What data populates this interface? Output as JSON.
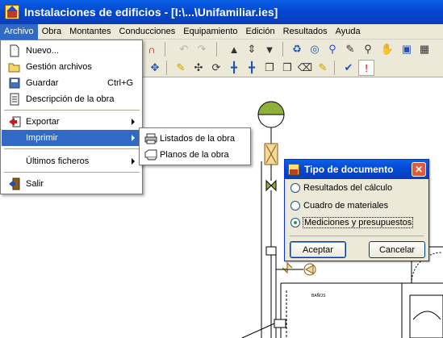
{
  "window": {
    "title": "Instalaciones de edificios - [I:\\...\\Unifamiliar.ies]"
  },
  "menubar": {
    "items": [
      "Archivo",
      "Obra",
      "Montantes",
      "Conducciones",
      "Equipamiento",
      "Edición",
      "Resultados",
      "Ayuda"
    ],
    "active": "Archivo"
  },
  "archivo_menu": {
    "items": [
      {
        "label": "Nuevo...",
        "icon": "new-document-icon"
      },
      {
        "label": "Gestión archivos",
        "icon": "folder-open-icon"
      },
      {
        "label": "Guardar",
        "icon": "save-disk-icon",
        "shortcut": "Ctrl+G"
      },
      {
        "label": "Descripción de la obra",
        "icon": "document-description-icon"
      },
      {
        "label": "Exportar",
        "icon": "export-arrow-icon",
        "submenu": true
      },
      {
        "label": "Imprimir",
        "icon": "",
        "submenu": true,
        "highlighted": true
      },
      {
        "label": "Últimos ficheros",
        "icon": "",
        "submenu": true
      },
      {
        "label": "Salir",
        "icon": "exit-door-icon"
      }
    ]
  },
  "imprimir_submenu": {
    "items": [
      {
        "label": "Listados de la obra",
        "icon": "printer-icon"
      },
      {
        "label": "Planos de la obra",
        "icon": "plotter-icon"
      }
    ]
  },
  "dialog": {
    "title": "Tipo de documento",
    "options": [
      "Resultados del cálculo",
      "Cuadro de materiales",
      "Mediciones y presupuestos"
    ],
    "selected_index": 2,
    "ok_label": "Aceptar",
    "cancel_label": "Cancelar"
  },
  "canvas": {
    "labels": [
      "BAÑOS"
    ]
  },
  "colors": {
    "title_blue": "#0346d0",
    "menu_highlight": "#316ac5",
    "valve_green": "#8fb03a",
    "heater_tan": "#d9a441",
    "close_red": "#e25a37"
  }
}
